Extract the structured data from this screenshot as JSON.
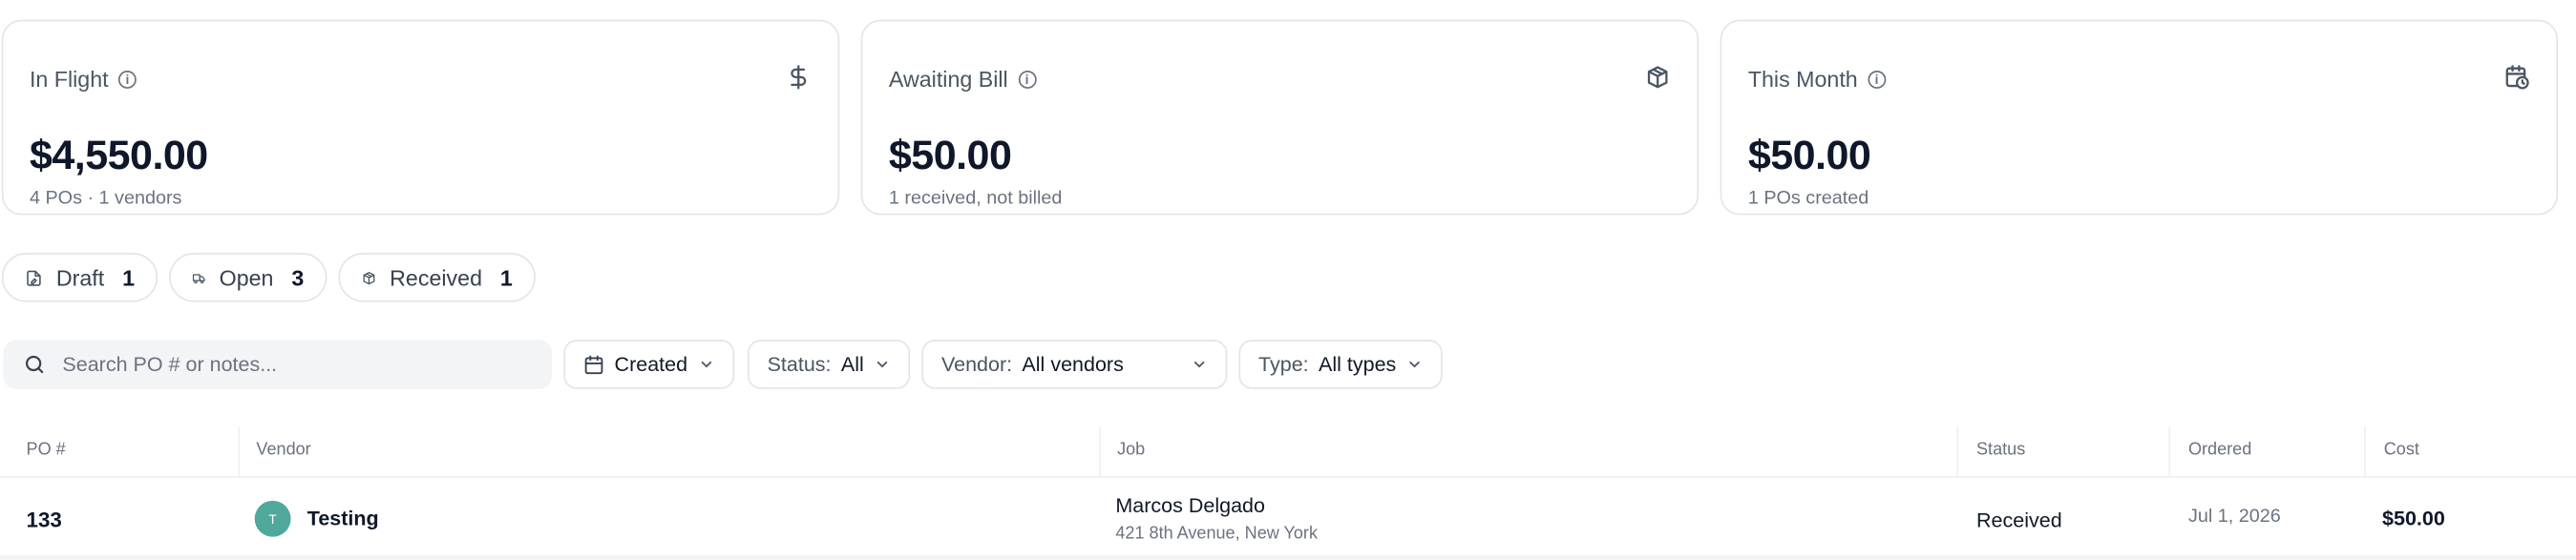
{
  "stats": [
    {
      "title": "In Flight",
      "value": "$4,550.00",
      "sub": "4 POs · 1 vendors",
      "icon": "dollar-icon"
    },
    {
      "title": "Awaiting Bill",
      "value": "$50.00",
      "sub": "1 received, not billed",
      "icon": "package-icon"
    },
    {
      "title": "This Month",
      "value": "$50.00",
      "sub": "1 POs created",
      "icon": "calendar-clock-icon"
    }
  ],
  "status_tabs": [
    {
      "label": "Draft",
      "count": "1",
      "icon": "file-edit-icon"
    },
    {
      "label": "Open",
      "count": "3",
      "icon": "truck-icon"
    },
    {
      "label": "Received",
      "count": "1",
      "icon": "box-icon"
    }
  ],
  "search": {
    "placeholder": "Search PO # or notes..."
  },
  "filters": {
    "created": {
      "value": "Created"
    },
    "status": {
      "label": "Status:",
      "value": "All"
    },
    "vendor": {
      "label": "Vendor:",
      "value": "All vendors"
    },
    "type": {
      "label": "Type:",
      "value": "All types"
    }
  },
  "table": {
    "columns": [
      "PO #",
      "Vendor",
      "Job",
      "Status",
      "Ordered",
      "Cost"
    ],
    "rows": [
      {
        "po": "133",
        "vendor_initial": "T",
        "vendor": "Testing",
        "job_name": "Marcos Delgado",
        "job_address": "421 8th Avenue, New York",
        "status": "Received",
        "ordered": "Jul 1, 2026",
        "cost": "$50.00"
      }
    ]
  },
  "colors": {
    "avatar": "#4fa89b",
    "border": "#e2e5ea",
    "search_bg": "#f3f4f6"
  }
}
